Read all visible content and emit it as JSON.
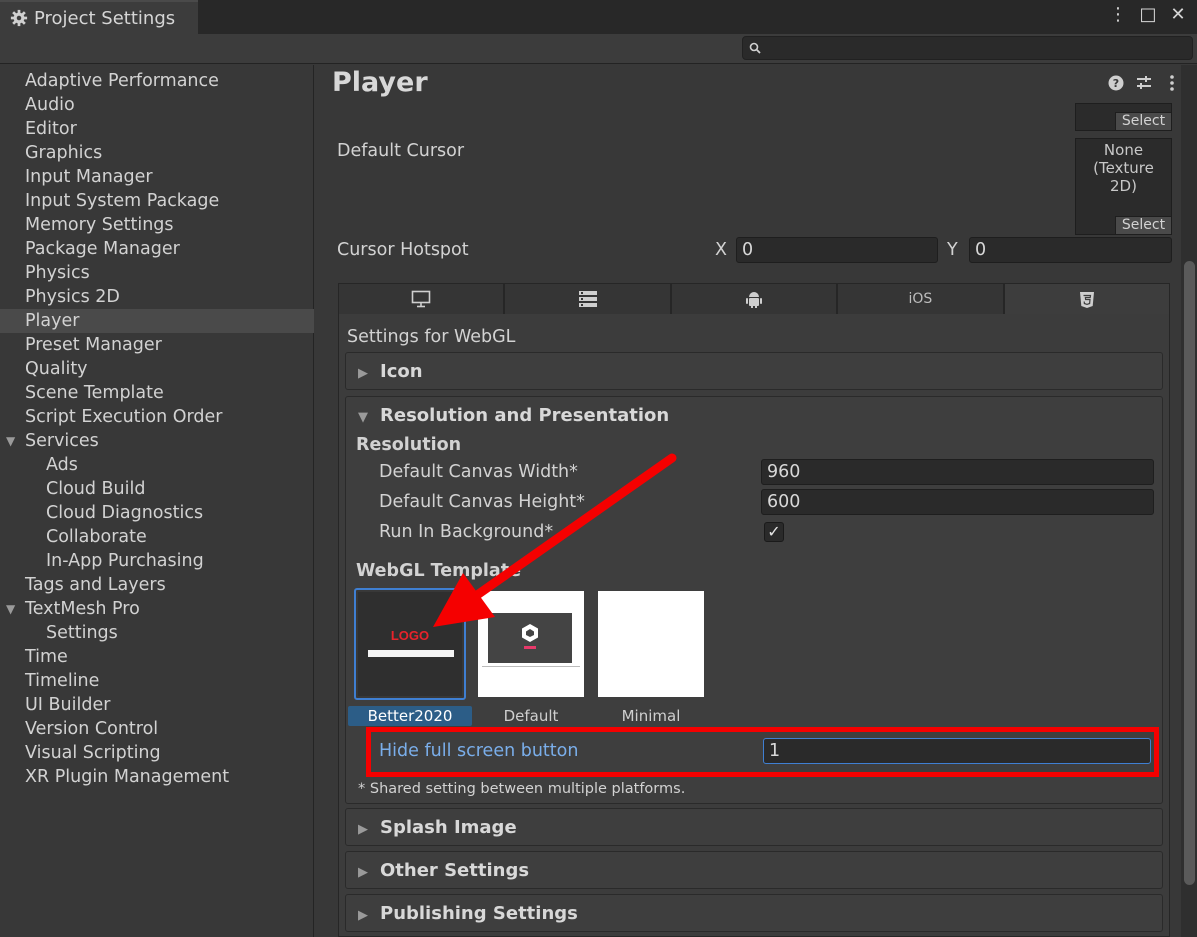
{
  "window": {
    "title": "Project Settings",
    "buttons": [
      "⋮",
      "□",
      "✕"
    ]
  },
  "search": {
    "placeholder": ""
  },
  "sidebar": {
    "items": [
      {
        "label": "Adaptive Performance",
        "indent": 0
      },
      {
        "label": "Audio",
        "indent": 0
      },
      {
        "label": "Editor",
        "indent": 0
      },
      {
        "label": "Graphics",
        "indent": 0
      },
      {
        "label": "Input Manager",
        "indent": 0
      },
      {
        "label": "Input System Package",
        "indent": 0
      },
      {
        "label": "Memory Settings",
        "indent": 0
      },
      {
        "label": "Package Manager",
        "indent": 0
      },
      {
        "label": "Physics",
        "indent": 0
      },
      {
        "label": "Physics 2D",
        "indent": 0
      },
      {
        "label": "Player",
        "indent": 0,
        "selected": true
      },
      {
        "label": "Preset Manager",
        "indent": 0
      },
      {
        "label": "Quality",
        "indent": 0
      },
      {
        "label": "Scene Template",
        "indent": 0
      },
      {
        "label": "Script Execution Order",
        "indent": 0
      },
      {
        "label": "Services",
        "indent": 0,
        "expanded": true
      },
      {
        "label": "Ads",
        "indent": 1
      },
      {
        "label": "Cloud Build",
        "indent": 1
      },
      {
        "label": "Cloud Diagnostics",
        "indent": 1
      },
      {
        "label": "Collaborate",
        "indent": 1
      },
      {
        "label": "In-App Purchasing",
        "indent": 1
      },
      {
        "label": "Tags and Layers",
        "indent": 0
      },
      {
        "label": "TextMesh Pro",
        "indent": 0,
        "expanded": true
      },
      {
        "label": "Settings",
        "indent": 1
      },
      {
        "label": "Time",
        "indent": 0
      },
      {
        "label": "Timeline",
        "indent": 0
      },
      {
        "label": "UI Builder",
        "indent": 0
      },
      {
        "label": "Version Control",
        "indent": 0
      },
      {
        "label": "Visual Scripting",
        "indent": 0
      },
      {
        "label": "XR Plugin Management",
        "indent": 0
      }
    ]
  },
  "main": {
    "title": "Player",
    "select_label": "Select",
    "default_cursor": {
      "label": "Default Cursor",
      "value": "None (Texture 2D)"
    },
    "cursor_hotspot": {
      "label": "Cursor Hotspot",
      "x_label": "X",
      "x_value": "0",
      "y_label": "Y",
      "y_value": "0"
    },
    "platform_tabs": [
      {
        "icon": "monitor-icon",
        "label": ""
      },
      {
        "icon": "server-icon",
        "label": ""
      },
      {
        "icon": "android-icon",
        "label": ""
      },
      {
        "icon": "",
        "label": "iOS"
      },
      {
        "icon": "html5-icon",
        "label": "",
        "active": true
      }
    ],
    "settings_for": "Settings for WebGL",
    "sections": {
      "icon": "Icon",
      "resolution": "Resolution and Presentation",
      "splash": "Splash Image",
      "other": "Other Settings",
      "publishing": "Publishing Settings"
    },
    "resolution": {
      "heading": "Resolution",
      "canvas_width_label": "Default Canvas Width*",
      "canvas_width_value": "960",
      "canvas_height_label": "Default Canvas Height*",
      "canvas_height_value": "600",
      "run_in_background_label": "Run In Background*",
      "run_in_background": true
    },
    "webgl_template": {
      "heading": "WebGL Template",
      "templates": [
        {
          "name": "Better2020",
          "selected": true,
          "logo_text": "LOGO"
        },
        {
          "name": "Default",
          "selected": false
        },
        {
          "name": "Minimal",
          "selected": false
        }
      ]
    },
    "hide_fullscreen": {
      "label": "Hide full screen button",
      "value": "1"
    },
    "shared_note": "* Shared setting between multiple platforms."
  },
  "colors": {
    "annotation": "#f50000",
    "link_label": "#7aaeea",
    "selected_template": "#2c5d87"
  }
}
